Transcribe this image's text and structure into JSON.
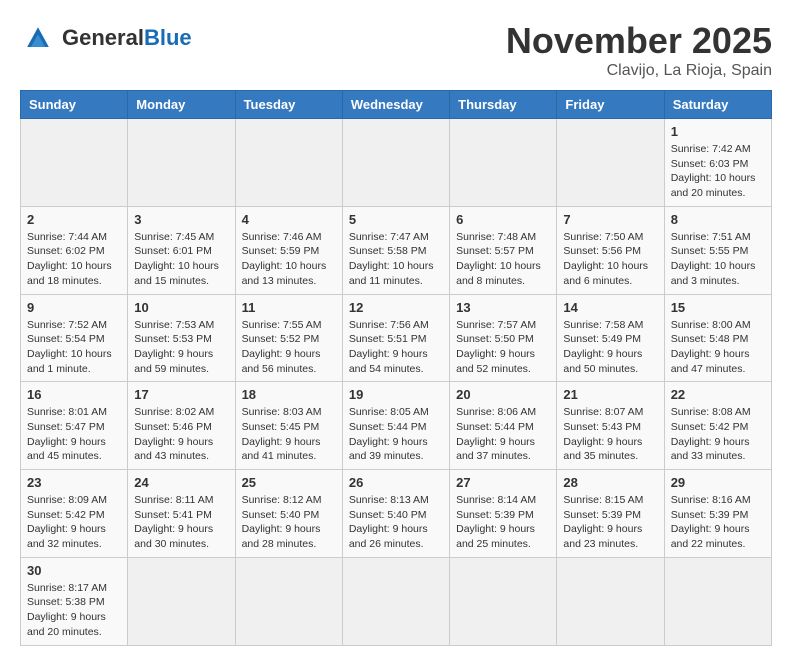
{
  "logo": {
    "text_general": "General",
    "text_blue": "Blue"
  },
  "title": "November 2025",
  "location": "Clavijo, La Rioja, Spain",
  "days_of_week": [
    "Sunday",
    "Monday",
    "Tuesday",
    "Wednesday",
    "Thursday",
    "Friday",
    "Saturday"
  ],
  "weeks": [
    [
      {
        "day": "",
        "info": ""
      },
      {
        "day": "",
        "info": ""
      },
      {
        "day": "",
        "info": ""
      },
      {
        "day": "",
        "info": ""
      },
      {
        "day": "",
        "info": ""
      },
      {
        "day": "",
        "info": ""
      },
      {
        "day": "1",
        "info": "Sunrise: 7:42 AM\nSunset: 6:03 PM\nDaylight: 10 hours and 20 minutes."
      }
    ],
    [
      {
        "day": "2",
        "info": "Sunrise: 7:44 AM\nSunset: 6:02 PM\nDaylight: 10 hours and 18 minutes."
      },
      {
        "day": "3",
        "info": "Sunrise: 7:45 AM\nSunset: 6:01 PM\nDaylight: 10 hours and 15 minutes."
      },
      {
        "day": "4",
        "info": "Sunrise: 7:46 AM\nSunset: 5:59 PM\nDaylight: 10 hours and 13 minutes."
      },
      {
        "day": "5",
        "info": "Sunrise: 7:47 AM\nSunset: 5:58 PM\nDaylight: 10 hours and 11 minutes."
      },
      {
        "day": "6",
        "info": "Sunrise: 7:48 AM\nSunset: 5:57 PM\nDaylight: 10 hours and 8 minutes."
      },
      {
        "day": "7",
        "info": "Sunrise: 7:50 AM\nSunset: 5:56 PM\nDaylight: 10 hours and 6 minutes."
      },
      {
        "day": "8",
        "info": "Sunrise: 7:51 AM\nSunset: 5:55 PM\nDaylight: 10 hours and 3 minutes."
      }
    ],
    [
      {
        "day": "9",
        "info": "Sunrise: 7:52 AM\nSunset: 5:54 PM\nDaylight: 10 hours and 1 minute."
      },
      {
        "day": "10",
        "info": "Sunrise: 7:53 AM\nSunset: 5:53 PM\nDaylight: 9 hours and 59 minutes."
      },
      {
        "day": "11",
        "info": "Sunrise: 7:55 AM\nSunset: 5:52 PM\nDaylight: 9 hours and 56 minutes."
      },
      {
        "day": "12",
        "info": "Sunrise: 7:56 AM\nSunset: 5:51 PM\nDaylight: 9 hours and 54 minutes."
      },
      {
        "day": "13",
        "info": "Sunrise: 7:57 AM\nSunset: 5:50 PM\nDaylight: 9 hours and 52 minutes."
      },
      {
        "day": "14",
        "info": "Sunrise: 7:58 AM\nSunset: 5:49 PM\nDaylight: 9 hours and 50 minutes."
      },
      {
        "day": "15",
        "info": "Sunrise: 8:00 AM\nSunset: 5:48 PM\nDaylight: 9 hours and 47 minutes."
      }
    ],
    [
      {
        "day": "16",
        "info": "Sunrise: 8:01 AM\nSunset: 5:47 PM\nDaylight: 9 hours and 45 minutes."
      },
      {
        "day": "17",
        "info": "Sunrise: 8:02 AM\nSunset: 5:46 PM\nDaylight: 9 hours and 43 minutes."
      },
      {
        "day": "18",
        "info": "Sunrise: 8:03 AM\nSunset: 5:45 PM\nDaylight: 9 hours and 41 minutes."
      },
      {
        "day": "19",
        "info": "Sunrise: 8:05 AM\nSunset: 5:44 PM\nDaylight: 9 hours and 39 minutes."
      },
      {
        "day": "20",
        "info": "Sunrise: 8:06 AM\nSunset: 5:44 PM\nDaylight: 9 hours and 37 minutes."
      },
      {
        "day": "21",
        "info": "Sunrise: 8:07 AM\nSunset: 5:43 PM\nDaylight: 9 hours and 35 minutes."
      },
      {
        "day": "22",
        "info": "Sunrise: 8:08 AM\nSunset: 5:42 PM\nDaylight: 9 hours and 33 minutes."
      }
    ],
    [
      {
        "day": "23",
        "info": "Sunrise: 8:09 AM\nSunset: 5:42 PM\nDaylight: 9 hours and 32 minutes."
      },
      {
        "day": "24",
        "info": "Sunrise: 8:11 AM\nSunset: 5:41 PM\nDaylight: 9 hours and 30 minutes."
      },
      {
        "day": "25",
        "info": "Sunrise: 8:12 AM\nSunset: 5:40 PM\nDaylight: 9 hours and 28 minutes."
      },
      {
        "day": "26",
        "info": "Sunrise: 8:13 AM\nSunset: 5:40 PM\nDaylight: 9 hours and 26 minutes."
      },
      {
        "day": "27",
        "info": "Sunrise: 8:14 AM\nSunset: 5:39 PM\nDaylight: 9 hours and 25 minutes."
      },
      {
        "day": "28",
        "info": "Sunrise: 8:15 AM\nSunset: 5:39 PM\nDaylight: 9 hours and 23 minutes."
      },
      {
        "day": "29",
        "info": "Sunrise: 8:16 AM\nSunset: 5:39 PM\nDaylight: 9 hours and 22 minutes."
      }
    ],
    [
      {
        "day": "30",
        "info": "Sunrise: 8:17 AM\nSunset: 5:38 PM\nDaylight: 9 hours and 20 minutes."
      },
      {
        "day": "",
        "info": ""
      },
      {
        "day": "",
        "info": ""
      },
      {
        "day": "",
        "info": ""
      },
      {
        "day": "",
        "info": ""
      },
      {
        "day": "",
        "info": ""
      },
      {
        "day": "",
        "info": ""
      }
    ]
  ]
}
